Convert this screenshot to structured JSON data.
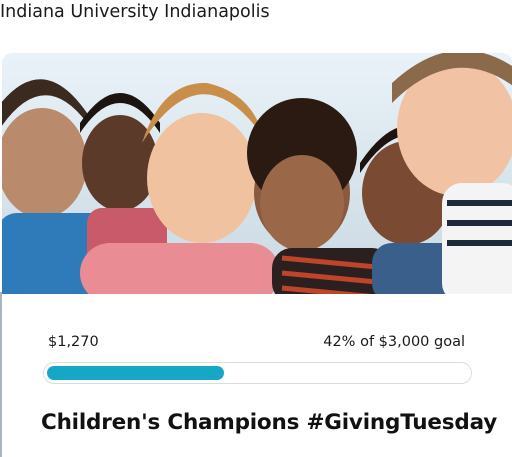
{
  "organization": {
    "name": "Indiana University Indianapolis"
  },
  "campaign": {
    "image_alt": "children-smiling-photo",
    "raised": "$1,270",
    "goal_text": "42% of $3,000 goal",
    "progress_percent": 42,
    "title": "Children's Champions #GivingTuesday"
  },
  "colors": {
    "progress_fill": "#16a6c6",
    "progress_border": "#d7dde1",
    "text": "#111111"
  }
}
